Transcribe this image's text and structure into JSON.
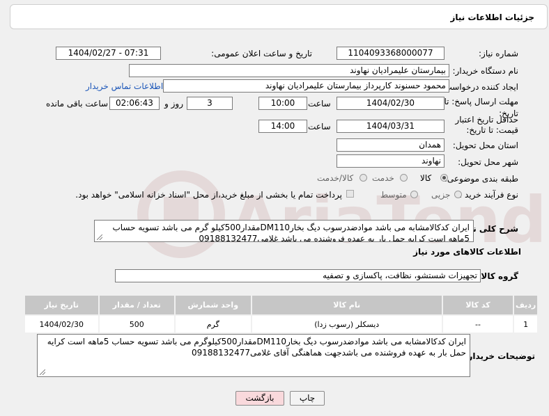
{
  "header": {
    "title": "جزئیات اطلاعات نیاز"
  },
  "labels": {
    "need_number": "شماره نیاز:",
    "announce_datetime": "تاریخ و ساعت اعلان عمومی:",
    "buyer_org": "نام دستگاه خریدار:",
    "requester": "ایجاد کننده درخواست:",
    "reply_deadline": "مهلت ارسال پاسخ: تا تاریخ:",
    "price_validity": "حداقل تاریخ اعتبار قیمت: تا تاریخ:",
    "province": "استان محل تحویل:",
    "city": "شهر محل تحویل:",
    "category": "طبقه بندی موضوعی:",
    "process": "نوع فرآیند خرید :",
    "hour": "ساعت",
    "day_and": "روز و",
    "hours_remaining": "ساعت باقی مانده",
    "general_desc": "شرح کلی نیاز:",
    "goods_info": "اطلاعات کالاهای مورد نیاز",
    "goods_group": "گروه کالا:",
    "buyer_notes": "توضیحات خریدار:"
  },
  "fields": {
    "need_number": "1104093368000077",
    "announce_datetime": "1404/02/27 - 07:31",
    "buyer_org": "بیمارستان علیمرادیان نهاوند",
    "requester": "محمود حسنوند کارپرداز بیمارستان علیمرادیان نهاوند",
    "contact_link": "اطلاعات تماس خریدار",
    "reply_date": "1404/02/30",
    "reply_time": "10:00",
    "reply_days": "3",
    "remaining_time": "02:06:43",
    "validity_date": "1404/03/31",
    "validity_time": "14:00",
    "province": "همدان",
    "city": "نهاوند",
    "goods_group": "تجهیزات شستشو، نظافت، پاکسازی و تصفیه"
  },
  "category_options": [
    {
      "label": "کالا",
      "selected": true
    },
    {
      "label": "خدمت",
      "selected": false
    },
    {
      "label": "کالا/خدمت",
      "selected": false
    }
  ],
  "process_options": [
    {
      "label": "جزیی",
      "selected": false
    },
    {
      "label": "متوسط",
      "selected": false
    }
  ],
  "payment_note": "پرداخت تمام یا بخشی از مبلغ خرید،از محل \"اسناد خزانه اسلامی\" خواهد بود.",
  "general_description": "ایران کدکالامشابه می باشد موادضدرسوب دیگ بخارDM110مقدار500کیلو گرم می باشد تسویه حساب 5ماهه است کرایه حمل بار به عهده فروشنده می باشد غلامی09188132477",
  "table": {
    "headers": [
      "ردیف",
      "کد کالا",
      "نام کالا",
      "واحد شمارش",
      "تعداد / مقدار",
      "تاریخ نیاز"
    ],
    "rows": [
      [
        "1",
        "--",
        "دیسکلر (رسوب زدا)",
        "گرم",
        "500",
        "1404/02/30"
      ]
    ]
  },
  "buyer_description": "ایران کدکالامشابه می باشد موادضدرسوب دیگ بخارDM110مقدار500کیلوگرم می باشد تسویه حساب 5ماهه است کرایه حمل بار به عهده فروشنده می باشدجهت هماهنگی آقای غلامی09188132477",
  "buttons": {
    "print": "چاپ",
    "back": "بازگشت"
  },
  "colors": {
    "link": "#1a55b8",
    "back_button": "#f9d9dc",
    "table_header": "#c6c6c6"
  }
}
